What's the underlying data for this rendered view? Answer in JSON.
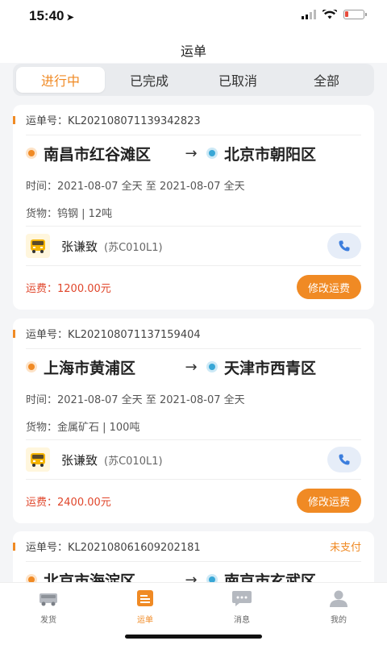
{
  "status": {
    "time": "15:40"
  },
  "header": {
    "title": "运单"
  },
  "tabs": [
    {
      "label": "进行中",
      "active": true
    },
    {
      "label": "已完成",
      "active": false
    },
    {
      "label": "已取消",
      "active": false
    },
    {
      "label": "全部",
      "active": false
    }
  ],
  "orders": [
    {
      "order_no": "运单号：KL202108071139342823",
      "tag": "",
      "from": "南昌市红谷滩区",
      "to": "北京市朝阳区",
      "time": "时间：2021-08-07 全天 至 2021-08-07 全天",
      "cargo": "货物：钨钢 | 12吨",
      "driver": "张谦致",
      "plate": "(苏C010L1)",
      "fee": "运费：1200.00元",
      "action": "修改运费"
    },
    {
      "order_no": "运单号：KL202108071137159404",
      "tag": "",
      "from": "上海市黄浦区",
      "to": "天津市西青区",
      "time": "时间：2021-08-07 全天 至 2021-08-07 全天",
      "cargo": "货物：金属矿石 | 100吨",
      "driver": "张谦致",
      "plate": "(苏C010L1)",
      "fee": "运费：2400.00元",
      "action": "修改运费"
    },
    {
      "order_no": "运单号：KL202108061609202181",
      "tag": "未支付",
      "from": "北京市海淀区",
      "to": "南京市玄武区"
    }
  ],
  "tabbar": [
    {
      "label": "发货",
      "icon": "truck-icon",
      "active": false
    },
    {
      "label": "运单",
      "icon": "waybill-icon",
      "active": true
    },
    {
      "label": "消息",
      "icon": "message-icon",
      "active": false
    },
    {
      "label": "我的",
      "icon": "user-icon",
      "active": false
    }
  ],
  "colors": {
    "accent": "#f08a24",
    "fee": "#e0462b",
    "to_dot": "#39a7d6"
  }
}
